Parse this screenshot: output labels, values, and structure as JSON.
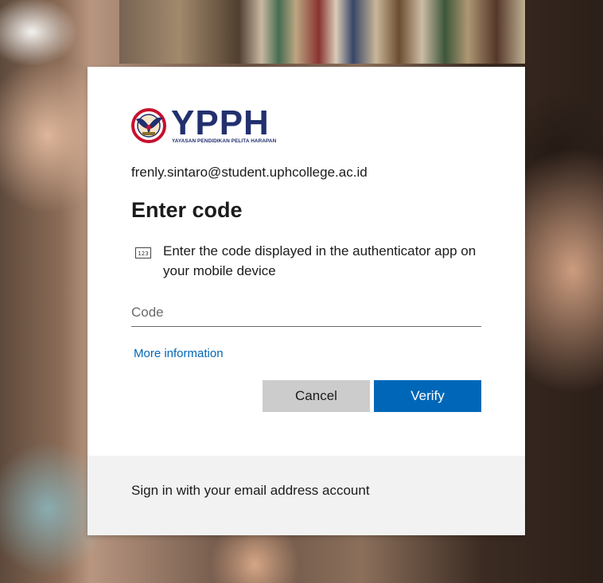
{
  "brand": {
    "logo_text": "YPPH",
    "logo_subtitle": "YAYASAN PENDIDIKAN PELITA HARAPAN",
    "primary_color": "#22306f",
    "accent_color": "#c8102e"
  },
  "account": {
    "email": "frenly.sintaro@student.uphcollege.ac.id"
  },
  "dialog": {
    "title": "Enter code",
    "instruction_icon": "numeric-keypad-icon",
    "instruction_icon_text": "123",
    "instruction": "Enter the code displayed in the authenticator app on your mobile device",
    "code_placeholder": "Code",
    "code_value": "",
    "more_info_link": "More information",
    "cancel_label": "Cancel",
    "verify_label": "Verify",
    "link_color": "#0067b8",
    "verify_color": "#0067b8"
  },
  "footer": {
    "text": "Sign in with your email address account"
  }
}
